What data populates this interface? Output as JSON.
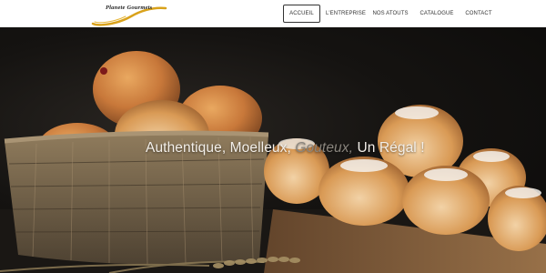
{
  "brand": {
    "logo_text": "Planete Gourmets",
    "logo_swoosh_color": "#d9a21b"
  },
  "nav": {
    "items": [
      {
        "label": "ACCUEIL",
        "active": true
      },
      {
        "label": "L'ENTREPRISE",
        "active": false
      },
      {
        "label": "NOS ATOUTS",
        "active": false
      },
      {
        "label": "CATALOGUE",
        "active": false
      },
      {
        "label": "CONTACT",
        "active": false
      }
    ]
  },
  "hero": {
    "text_part1": "Authentique, Moelleux,",
    "text_accent": "Gouteux,",
    "text_part3": "Un Régal !",
    "background_color": "#0f0d0c",
    "accent_color": "#8a857d"
  }
}
